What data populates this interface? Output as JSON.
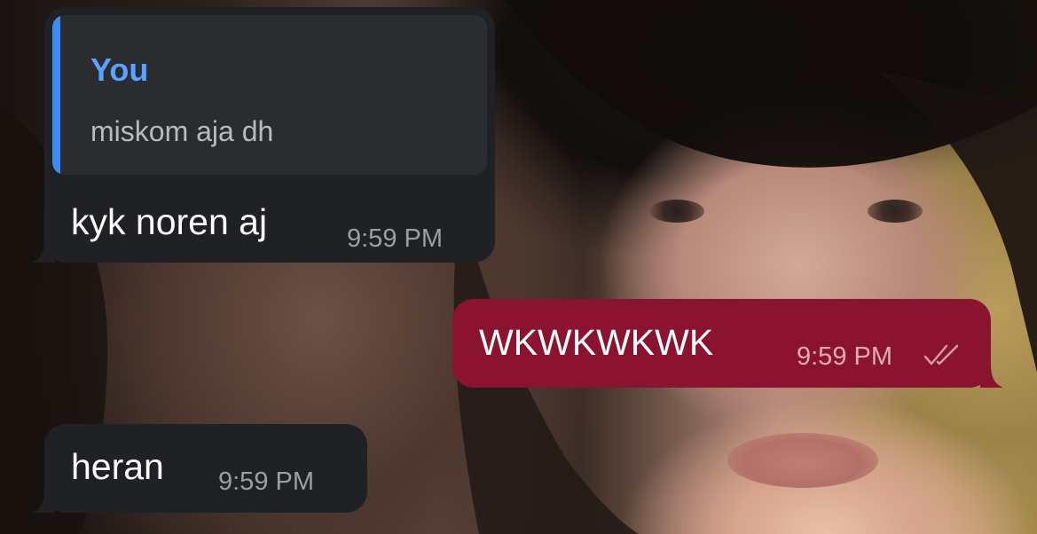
{
  "messages": [
    {
      "direction": "incoming",
      "reply": {
        "author": "You",
        "text": "miskom aja dh"
      },
      "text": "kyk noren aj",
      "time": "9:59 PM"
    },
    {
      "direction": "outgoing",
      "text": "WKWKWKWK",
      "time": "9:59 PM",
      "status_icon": "double-check-icon"
    },
    {
      "direction": "incoming",
      "text": "heran",
      "time": "9:59 PM"
    }
  ],
  "colors": {
    "incoming_bubble": "#1f2124",
    "outgoing_bubble": "#8a1430",
    "reply_accent": "#3d8cf4",
    "reply_author": "#5aa2ff"
  }
}
